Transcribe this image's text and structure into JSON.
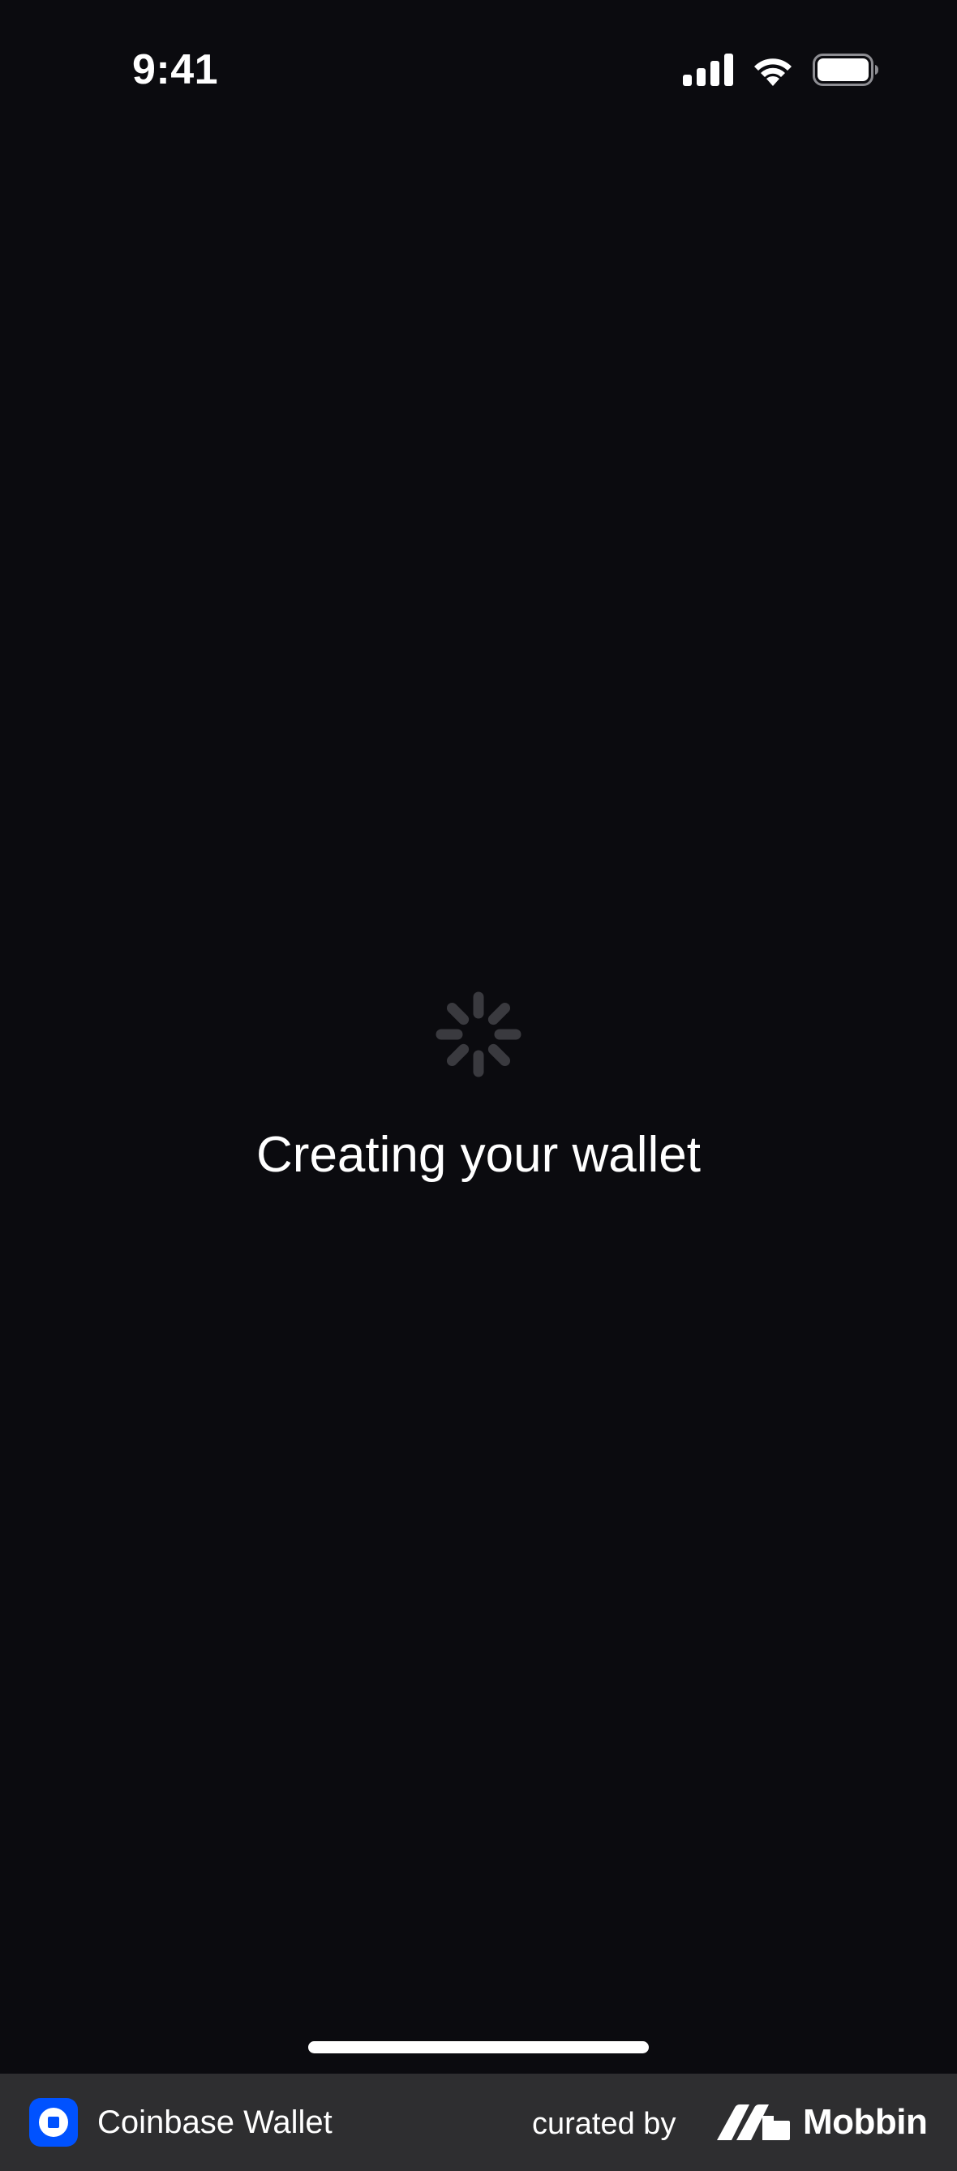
{
  "status_bar": {
    "time": "9:41",
    "icons": [
      "cellular-signal-icon",
      "wifi-icon",
      "battery-icon"
    ]
  },
  "loading": {
    "spinner_icon": "loading-spinner-icon",
    "message": "Creating your wallet"
  },
  "footer": {
    "app_icon": "coinbase-wallet-icon",
    "app_name": "Coinbase Wallet",
    "curated_by": "curated by",
    "brand_logo": "mobbin-logo-icon",
    "brand_name": "Mobbin"
  },
  "colors": {
    "background": "#0b0b0f",
    "text": "#ffffff",
    "spinner": "#3a3a3f",
    "footer_background": "#2e2e30",
    "brand_blue": "#0052ff"
  }
}
